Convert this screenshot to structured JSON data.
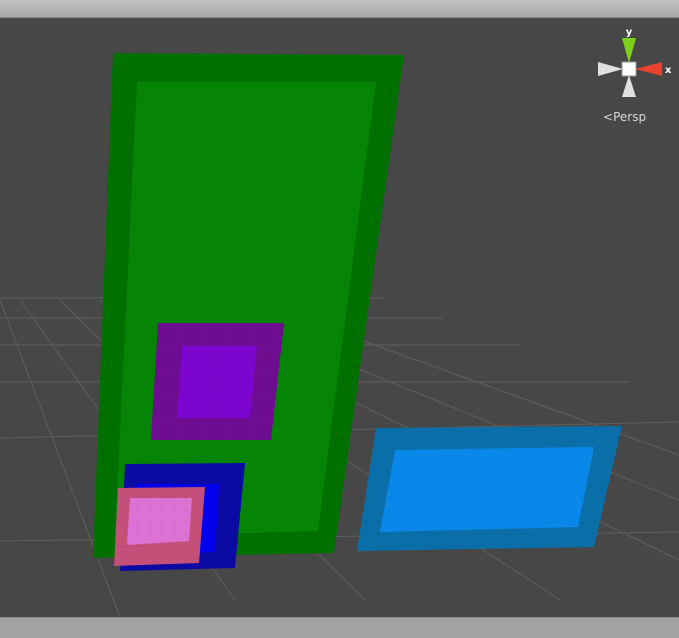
{
  "gizmo": {
    "y_axis_label": "y",
    "x_axis_label": "x",
    "projection_label": "Persp",
    "y_color": "#7cd11a",
    "x_color": "#e8412c",
    "neutral_color": "#e0e0e0"
  },
  "colors": {
    "viewport_background": "#474747",
    "grid_line": "#5d5d5d",
    "green_frame": "#007100",
    "green_fill": "#048104",
    "purple_frame": "#6e0d90",
    "purple_fill": "#7b04cc",
    "blue_frame": "#0b0ba3",
    "blue_fill": "#0000ee",
    "pink_frame": "#c4507a",
    "pink_fill": "#dc72d4",
    "cyan_frame": "#0a6fa8",
    "cyan_fill": "#0a87e8"
  }
}
